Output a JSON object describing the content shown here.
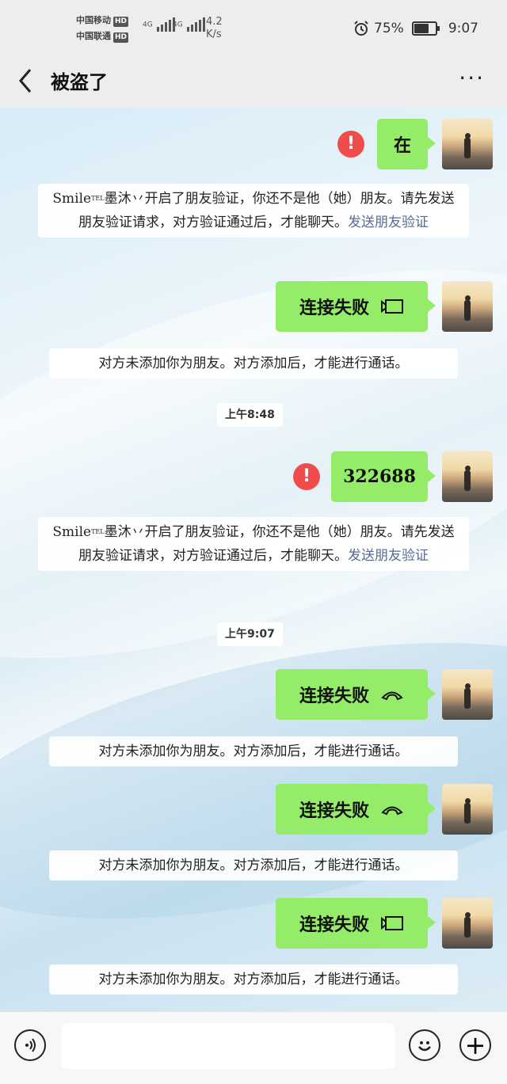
{
  "status_bar": {
    "carrier1": "中国移动",
    "carrier2": "中国联通",
    "hd": "HD",
    "net_type": "4G",
    "net_speed_value": "4.2",
    "net_speed_unit": "K/s",
    "battery_percent": "75%",
    "battery_level": 0.75,
    "time": "9:07"
  },
  "header": {
    "title": "被盗了",
    "back_icon": "chevron-left-icon",
    "more_icon": "ellipsis-icon",
    "more_glyph": "···"
  },
  "messages": {
    "m1": {
      "text": "在",
      "error_glyph": "!"
    },
    "sys1": {
      "prefix": "Smile",
      "tel": "TEL",
      "body": "墨沐丷开启了朋友验证，你还不是他（她）朋友。请先发送朋友验证请求，对方验证通过后，才能聊天。",
      "link": "发送朋友验证"
    },
    "call1": {
      "text": "连接失败",
      "icon": "video-call-icon"
    },
    "sys2": {
      "text": "对方未添加你为朋友。对方添加后，才能进行通话。"
    },
    "time1": "上午8:48",
    "m2": {
      "text": "322688",
      "error_glyph": "!"
    },
    "sys3": {
      "prefix": "Smile",
      "tel": "TEL",
      "body": "墨沐丷开启了朋友验证，你还不是他（她）朋友。请先发送朋友验证请求，对方验证通过后，才能聊天。",
      "link": "发送朋友验证"
    },
    "time2": "上午9:07",
    "call2": {
      "text": "连接失败",
      "icon": "voice-call-icon"
    },
    "sys4": {
      "text": "对方未添加你为朋友。对方添加后，才能进行通话。"
    },
    "call3": {
      "text": "连接失败",
      "icon": "voice-call-icon"
    },
    "sys5": {
      "text": "对方未添加你为朋友。对方添加后，才能进行通话。"
    },
    "call4": {
      "text": "连接失败",
      "icon": "video-call-icon"
    },
    "sys6": {
      "text": "对方未添加你为朋友。对方添加后，才能进行通话。"
    }
  },
  "input_bar": {
    "voice_icon": "voice-input-icon",
    "emoji_icon": "emoji-icon",
    "plus_icon": "plus-icon",
    "plus_glyph": "+"
  },
  "colors": {
    "bubble": "#95ec69",
    "error": "#f04c4c",
    "link": "#576b95",
    "bar": "#ededed"
  }
}
